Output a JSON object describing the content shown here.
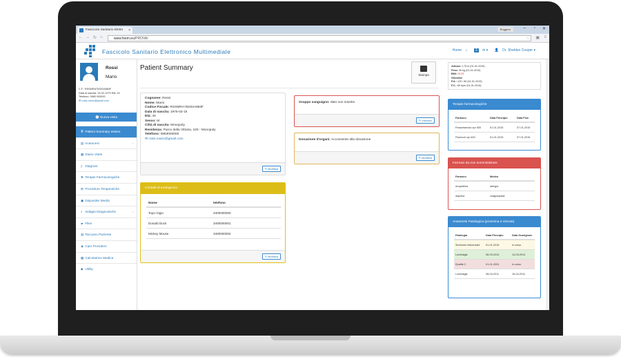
{
  "browser": {
    "tab_title": "Fascicolo Sanitario Eletto",
    "user_label": "Ruggero",
    "url_host": "www.fsem.eu",
    "url_path": "/PROVA/"
  },
  "app": {
    "title": "Fascicolo Sanitario Elettronico Multimediale",
    "nav_home": "Home",
    "nav_badge": "3",
    "nav_user": "Dr. Sheldon Cooper"
  },
  "patient": {
    "surname": "Rossi",
    "name": "Mario",
    "cf_line": "C.F.: RSSMRA75S02A883F",
    "birth_line": "Data di nascita: 15-02-1975  Età: 40",
    "phone_line": "Telefono: 0883 000000",
    "email": "rossi.mario@gmail.com"
  },
  "sidebar": {
    "new_visit": "Nuova visita",
    "items": [
      {
        "label": "Patient Summary esteso",
        "icon": "list-icon"
      },
      {
        "label": "Anamnesi",
        "icon": "book-icon"
      },
      {
        "label": "Diario Visite",
        "icon": "calendar-icon"
      },
      {
        "label": "Diagnosi",
        "icon": "file-icon"
      },
      {
        "label": "Terapie Farmacologiche",
        "icon": "medkit-icon"
      },
      {
        "label": "Procedure Terapeutiche",
        "icon": "hospital-icon"
      },
      {
        "label": "Dispositivi Medici",
        "icon": "device-icon"
      },
      {
        "label": "Indagini Diagnostiche",
        "icon": "search-icon"
      },
      {
        "label": "Files",
        "icon": "folder-icon"
      },
      {
        "label": "Taccuino Paziente",
        "icon": "notebook-icon"
      },
      {
        "label": "Care Providers",
        "icon": "user-icon"
      },
      {
        "label": "Calcolatrice Medica",
        "icon": "calculator-icon"
      },
      {
        "label": "Utility",
        "icon": "tags-icon"
      }
    ]
  },
  "main": {
    "page_title": "Patient Summary",
    "print_label": "Stampa",
    "modify_label": "Modifica",
    "insert_label": "Inserisci",
    "anag": {
      "cognome_k": "Cognome:",
      "cognome_v": "Rossi",
      "nome_k": "Nome:",
      "nome_v": "Mario",
      "cf_k": "Codice Fiscale:",
      "cf_v": "RSSMRA75S02A883F",
      "dn_k": "Data di nascita:",
      "dn_v": "1975-02-15",
      "eta_k": "Età:",
      "eta_v": "40",
      "sesso_k": "Sesso:",
      "sesso_v": "M",
      "citta_k": "Città di nascita:",
      "citta_v": "Monopoly",
      "res_k": "Residenza:",
      "res_v": "Parco della Vittoria, 100 - Monopoly",
      "tel_k": "Telefono:",
      "tel_v": "0883000000",
      "email": "rossi.mario@gmail.com"
    },
    "emergency": {
      "title": "Contatti di emergenza",
      "col_name": "Nome",
      "col_phone": "telefono",
      "rows": [
        {
          "name": "Topo Gigio",
          "phone": "3400000000"
        },
        {
          "name": "Donald Duck",
          "phone": "3400000001"
        },
        {
          "name": "Mickey Mouse",
          "phone": "3400000002"
        }
      ]
    },
    "blood": {
      "label": "Gruppo sanguigno:",
      "value": "dato non inserito"
    },
    "organs": {
      "label": "Donazione d'organi:",
      "value": "Acconsente alla donazione"
    }
  },
  "right": {
    "vitals": [
      {
        "k": "Altezza:",
        "v": "1.75 m (01-01-2015)",
        "red": false
      },
      {
        "k": "Peso:",
        "v": "90 kg (01-01-2015)",
        "red": false
      },
      {
        "k": "BMI:",
        "v": "29.39",
        "red": true
      },
      {
        "k": "Glicemia:",
        "v": "",
        "red": false
      },
      {
        "k": "P.A.:",
        "v": "120 / 80 (01-01-2015)",
        "red": false
      },
      {
        "k": "F.C.:",
        "v": "80 bpm (01-01-2015)",
        "red": false
      }
    ],
    "therapies": {
      "title": "Terapie farmacologiche",
      "cols": [
        "Farmaco",
        "Data Principio",
        "Data Fine"
      ],
      "rows": [
        [
          "Paracetamolo cpr 500",
          "01-01-2015",
          "07-01-2015"
        ],
        [
          "Fluimucil cpr 600",
          "01-01-2015",
          "07-01-2015"
        ]
      ]
    },
    "not_admin": {
      "title": "Farmaci da non somministrare",
      "cols": [
        "Farmaco",
        "Motivo"
      ],
      "rows": [
        [
          "Ampicillina",
          "allergia"
        ],
        [
          "aspirina",
          "coagulopatia"
        ]
      ]
    },
    "pathology": {
      "title": "Anamnesi Patologica (prossima e remota)",
      "cols": [
        "Patologia",
        "Data Principio",
        "Data Guarigione"
      ],
      "rows": [
        {
          "cells": [
            "Sindrome influenzale",
            "01-01-2015",
            "in corso"
          ],
          "status": "warn"
        },
        {
          "cells": [
            "Lombalgia",
            "08-03-2014",
            "14-03-2014"
          ],
          "status": "ok"
        },
        {
          "cells": [
            "Epatite C",
            "01-01-2001",
            "in corso"
          ],
          "status": "err"
        },
        {
          "cells": [
            "Lombalgia",
            "08-04-2011",
            "15-04-2011"
          ],
          "status": ""
        }
      ]
    }
  },
  "colors": {
    "brand": "#2a7ab8",
    "warning": "#e0c01a",
    "danger": "#d9534f",
    "primary": "#3a8ad0"
  }
}
